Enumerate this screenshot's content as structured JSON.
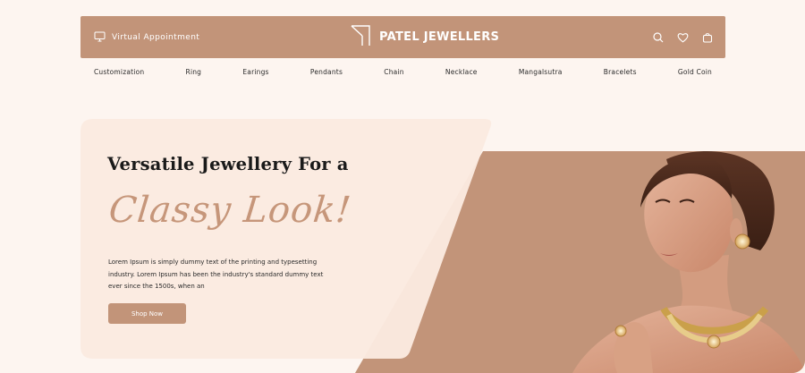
{
  "header": {
    "appointment_label": "Virtual Appointment",
    "brand_name": "PATEL JEWELLERS",
    "icons": [
      "search-icon",
      "heart-icon",
      "bag-icon"
    ]
  },
  "nav": {
    "items": [
      "Customization",
      "Ring",
      "Earings",
      "Pendants",
      "Chain",
      "Necklace",
      "Mangalsutra",
      "Bracelets",
      "Gold Coin"
    ]
  },
  "hero": {
    "headline": "Versatile Jewellery For a",
    "script_line": "Classy Look!",
    "description": "Lorem Ipsum is simply dummy text of the printing and typesetting industry. Lorem Ipsum has been the industry's standard dummy text ever since the 1500s, when an",
    "cta_label": "Shop Now"
  },
  "colors": {
    "accent": "#c29479",
    "background": "#fdf5f0",
    "card": "#fbeae0",
    "script": "#c6967a"
  }
}
